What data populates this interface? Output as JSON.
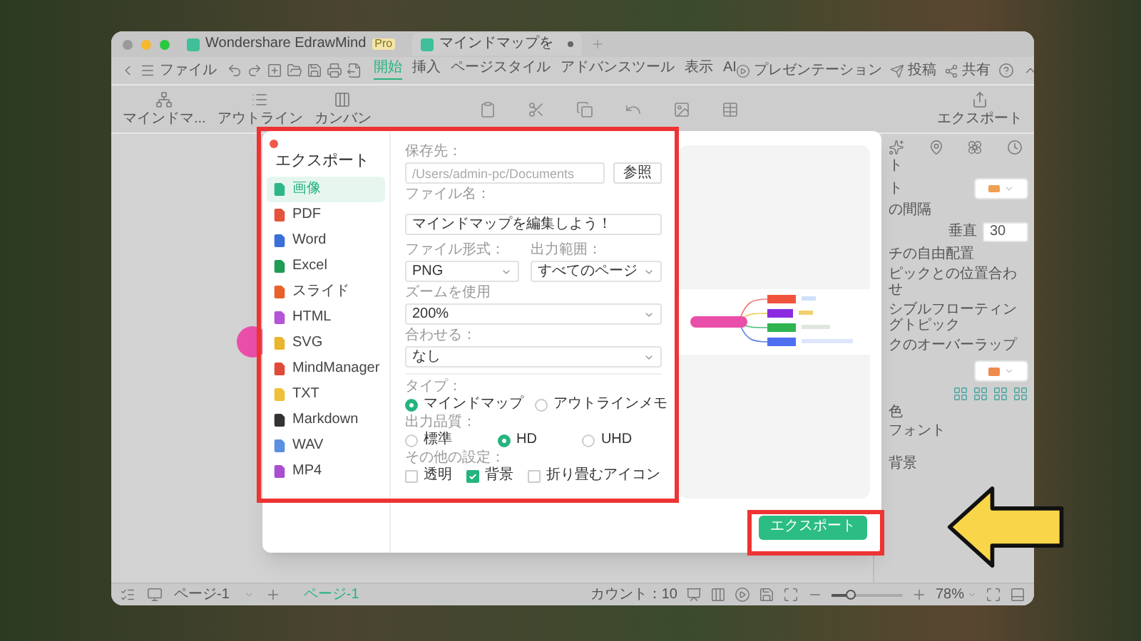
{
  "window": {
    "tabs": [
      {
        "label": "Wondershare EdrawMind",
        "badge": "Pro",
        "selected": false
      },
      {
        "label": "マインドマップを",
        "selected": true
      }
    ]
  },
  "toolbar": {
    "file_menu": "ファイル",
    "ribbon_tabs": [
      {
        "label": "開始",
        "selected": true
      },
      {
        "label": "挿入",
        "selected": false
      },
      {
        "label": "ページスタイル",
        "selected": false
      },
      {
        "label": "アドバンスツール",
        "selected": false
      },
      {
        "label": "表示",
        "selected": false
      },
      {
        "label": "AI",
        "selected": false
      }
    ],
    "actions": [
      {
        "kind": "present",
        "label": "プレゼンテーション"
      },
      {
        "kind": "post",
        "label": "投稿"
      },
      {
        "kind": "share",
        "label": "共有"
      }
    ]
  },
  "ribbon": {
    "buttons": [
      {
        "kind": "mindmap",
        "label": "マインドマ..."
      },
      {
        "kind": "outline",
        "label": "アウトライン"
      },
      {
        "kind": "kanban",
        "label": "カンバン"
      }
    ],
    "export_label": "エクスポート"
  },
  "right_panel": {
    "heading": "ト",
    "layout_label": "ト",
    "spacing_label": "の間隔",
    "vertical_label": "垂直",
    "vertical_value": "30",
    "options": [
      "チの自由配置",
      "ピックとの位置合わせ",
      "シブルフローティングトピック",
      "クのオーバーラップ"
    ],
    "color_label": "色",
    "font_label": "フォント",
    "background_label": "背景"
  },
  "status_bar": {
    "page_select": "ページ-1",
    "page_tab": "ページ-1",
    "count": "カウント：10",
    "zoom": "78%",
    "zoom_slider": {
      "level": 0.35
    }
  },
  "export_dialog": {
    "title": "エクスポート",
    "formats": [
      {
        "label": "画像",
        "color": "#2fb58a",
        "selected": true
      },
      {
        "label": "PDF",
        "color": "#e5533d",
        "selected": false
      },
      {
        "label": "Word",
        "color": "#3b6fd8",
        "selected": false
      },
      {
        "label": "Excel",
        "color": "#1f9d55",
        "selected": false
      },
      {
        "label": "スライド",
        "color": "#e8612c",
        "selected": false
      },
      {
        "label": "HTML",
        "color": "#b554d6",
        "selected": false
      },
      {
        "label": "SVG",
        "color": "#e8b52c",
        "selected": false
      },
      {
        "label": "MindManager",
        "color": "#e04a3a",
        "selected": false
      },
      {
        "label": "TXT",
        "color": "#f0c03a",
        "selected": false
      },
      {
        "label": "Markdown",
        "color": "#333333",
        "selected": false
      },
      {
        "label": "WAV",
        "color": "#5b8fe0",
        "selected": false
      },
      {
        "label": "MP4",
        "color": "#a84fd0",
        "selected": false
      }
    ],
    "save_to": {
      "label": "保存先：",
      "placeholder": "/Users/admin-pc/Documents",
      "browse": "参照"
    },
    "file_name": {
      "label": "ファイル名：",
      "value": "マインドマップを編集しよう！"
    },
    "file_format": {
      "label": "ファイル形式：",
      "value": "PNG"
    },
    "output_range": {
      "label": "出力範囲：",
      "value": "すべてのページ"
    },
    "zoom": {
      "label": "ズームを使用",
      "value": "200%"
    },
    "fit": {
      "label": "合わせる：",
      "value": "なし"
    },
    "type": {
      "label": "タイプ：",
      "options": [
        {
          "label": "マインドマップ",
          "selected": true
        },
        {
          "label": "アウトラインメモ",
          "selected": false
        }
      ]
    },
    "quality": {
      "label": "出力品質：",
      "options": [
        {
          "label": "標準",
          "selected": false
        },
        {
          "label": "HD",
          "selected": true
        },
        {
          "label": "UHD",
          "selected": false
        }
      ]
    },
    "other": {
      "label": "その他の設定：",
      "options": [
        {
          "label": "透明",
          "checked": false
        },
        {
          "label": "背景",
          "checked": true
        },
        {
          "label": "折り畳むアイコン",
          "checked": false
        }
      ]
    },
    "export_button": "エクスポート"
  }
}
